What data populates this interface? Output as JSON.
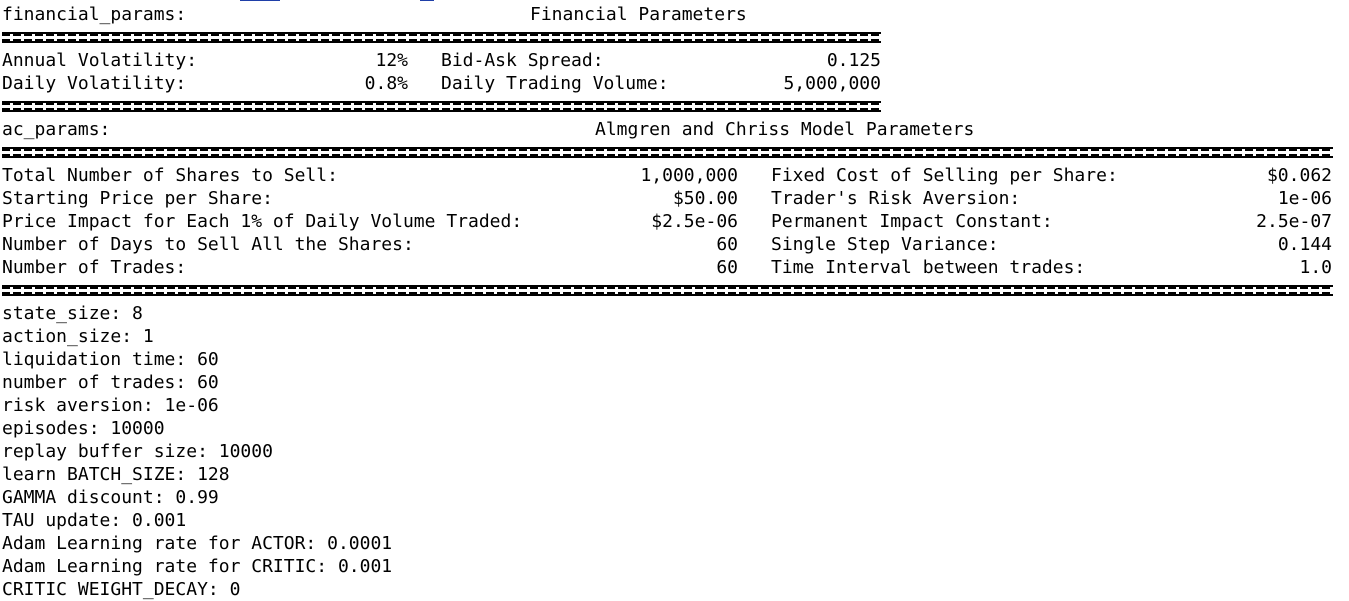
{
  "financial": {
    "var_name": "financial_params:",
    "title": "Financial Parameters",
    "rows": [
      {
        "label": "Annual Volatility:",
        "value": "12%",
        "label2": "Bid-Ask Spread:",
        "value2": "0.125"
      },
      {
        "label": "Daily Volatility:",
        "value": "0.8%",
        "label2": "Daily Trading Volume:",
        "value2": "5,000,000"
      }
    ]
  },
  "ac": {
    "var_name": "ac_params:",
    "title": "Almgren and Chriss Model Parameters",
    "rows": [
      {
        "label": "Total Number of Shares to Sell:",
        "value": "1,000,000",
        "label2": "Fixed Cost of Selling per Share:",
        "value2": "$0.062"
      },
      {
        "label": "Starting Price per Share:",
        "value": "$50.00",
        "label2": "Trader's Risk Aversion:",
        "value2": "1e-06"
      },
      {
        "label": "Price Impact for Each 1% of Daily Volume Traded:",
        "value": "$2.5e-06",
        "label2": "Permanent Impact Constant:",
        "value2": "2.5e-07"
      },
      {
        "label": "Number of Days to Sell All the Shares:",
        "value": "60",
        "label2": "Single Step Variance:",
        "value2": "0.144"
      },
      {
        "label": "Number of Trades:",
        "value": "60",
        "label2": "Time Interval between trades:",
        "value2": "1.0"
      }
    ]
  },
  "output_lines": [
    "state_size: 8",
    "action_size: 1",
    "liquidation time: 60",
    "number of trades: 60",
    "risk aversion: 1e-06",
    "episodes: 10000",
    "replay buffer size: 10000",
    "learn BATCH_SIZE: 128",
    "GAMMA discount: 0.99",
    "TAU update: 0.001",
    "Adam Learning rate for ACTOR: 0.0001",
    "Adam Learning rate for CRITIC: 0.001",
    "CRITIC WEIGHT_DECAY: 0"
  ]
}
